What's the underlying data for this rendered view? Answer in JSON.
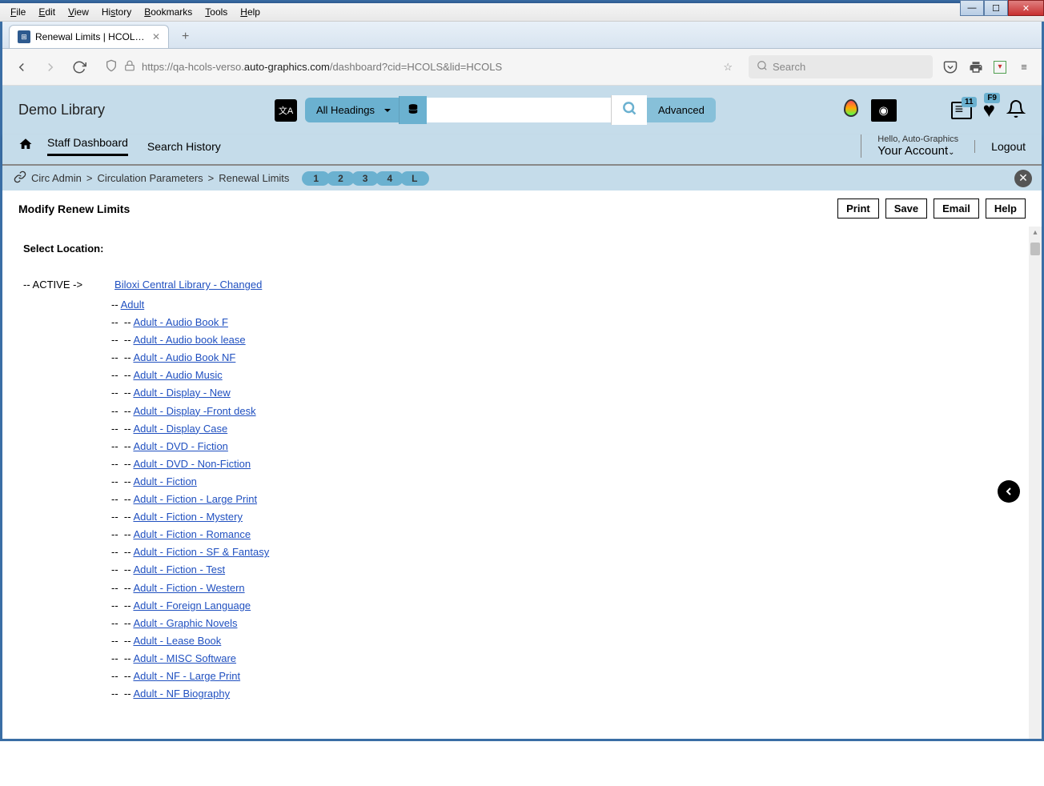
{
  "window": {
    "menus": [
      "File",
      "Edit",
      "View",
      "History",
      "Bookmarks",
      "Tools",
      "Help"
    ]
  },
  "browser": {
    "tab_title": "Renewal Limits | HCOLS | hcols",
    "url_prefix": "https://qa-hcols-verso.",
    "url_domain": "auto-graphics.com",
    "url_suffix": "/dashboard?cid=HCOLS&lid=HCOLS",
    "search_placeholder": "Search"
  },
  "header": {
    "library_name": "Demo Library",
    "headings_label": "All Headings",
    "advanced_label": "Advanced",
    "badge_list": "11",
    "badge_heart": "F9"
  },
  "nav": {
    "staff_dashboard": "Staff Dashboard",
    "search_history": "Search History",
    "hello": "Hello, Auto-Graphics",
    "your_account": "Your Account",
    "logout": "Logout"
  },
  "breadcrumb": {
    "items": [
      "Circ Admin",
      "Circulation Parameters",
      "Renewal Limits"
    ],
    "steps": [
      "1",
      "2",
      "3",
      "4",
      "L"
    ]
  },
  "page": {
    "title": "Modify Renew Limits",
    "buttons": {
      "print": "Print",
      "save": "Save",
      "email": "Email",
      "help": "Help"
    },
    "select_location": "Select Location:",
    "active_label": "-- ACTIVE ->",
    "main_location": "Biloxi Central Library - Changed",
    "level1": [
      "Adult"
    ],
    "level2": [
      "Adult - Audio Book F",
      "Adult - Audio book lease",
      "Adult - Audio Book NF",
      "Adult - Audio Music",
      "Adult - Display - New",
      "Adult - Display -Front desk",
      "Adult - Display Case",
      "Adult - DVD - Fiction",
      "Adult - DVD - Non-Fiction",
      "Adult - Fiction",
      "Adult - Fiction - Large Print",
      "Adult - Fiction - Mystery",
      "Adult - Fiction - Romance",
      "Adult - Fiction - SF & Fantasy",
      "Adult - Fiction - Test",
      "Adult - Fiction - Western",
      "Adult - Foreign Language",
      "Adult - Graphic Novels",
      "Adult - Lease Book",
      "Adult - MISC Software",
      "Adult - NF - Large Print",
      "Adult - NF Biography"
    ]
  }
}
